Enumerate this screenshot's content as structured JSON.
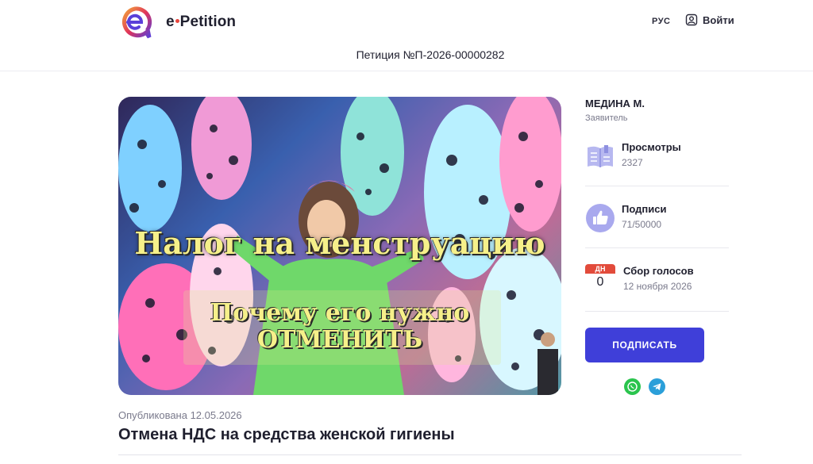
{
  "header": {
    "brand": "Petition",
    "brand_prefix": "e",
    "lang": "РУС",
    "login_label": "Войти",
    "petition_number": "Петиция №П-2026-00000282"
  },
  "hero": {
    "title": "Налог на менструацию",
    "subtitle_line1": "Почему его нужно",
    "subtitle_line2": "ОТМЕНИТЬ"
  },
  "sidebar": {
    "author_name": "МЕДИНА М.",
    "author_role": "Заявитель",
    "views_label": "Просмотры",
    "views_value": "2327",
    "signatures_label": "Подписи",
    "signatures_value": "71/50000",
    "collection_label": "Сбор голосов",
    "collection_date": "12 ноября 2026",
    "days_label": "ДН",
    "days_value": "0",
    "sign_button": "ПОДПИСАТЬ",
    "share": [
      "whatsapp-icon",
      "telegram-icon"
    ]
  },
  "main": {
    "published": "Опубликована 12.05.2026",
    "title": "Отмена НДС на средства женской гигиены"
  },
  "colors": {
    "accent": "#3f3fd9",
    "calendar": "#e24b3b",
    "whatsapp": "#2ac44d",
    "telegram": "#2b9fd9"
  }
}
